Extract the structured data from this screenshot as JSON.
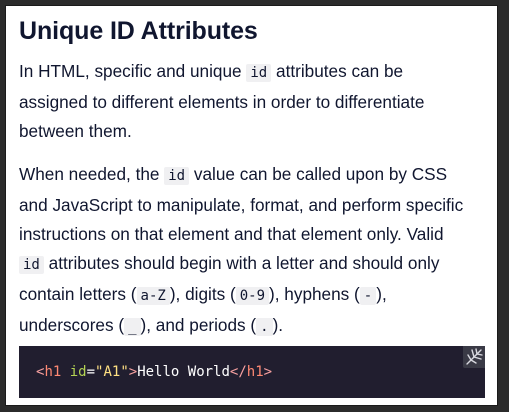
{
  "title": "Unique ID Attributes",
  "paragraph1": {
    "line1": {
      "before": "In HTML, specific and unique ",
      "code": "id",
      "after": " attributes can be"
    },
    "line2": "assigned to different elements in order to differentiate",
    "line3": "between them."
  },
  "paragraph2": {
    "line1": {
      "before": "When needed, the ",
      "code": "id",
      "after": " value can be called upon by CSS"
    },
    "line2": "and JavaScript to manipulate, format, and perform specific",
    "line3": "instructions on that element and that element only. Valid",
    "line4": {
      "code": "id",
      "after": " attributes should begin with a letter and should only"
    },
    "line5": {
      "t1": "contain letters (",
      "c1": "a-Z",
      "t2": "), digits (",
      "c2": "0-9",
      "t3": "), hyphens (",
      "c3": "-",
      "t4": "),"
    },
    "line6": {
      "t1": "underscores (",
      "c1": "_",
      "t2": "), and periods (",
      "c2": ".",
      "t3": ")."
    }
  },
  "code_example": {
    "open_lt": "<",
    "tag_open": "h1",
    "space": " ",
    "attr": "id",
    "eq": "=",
    "value": "\"A1\"",
    "open_gt": ">",
    "text": "Hello World",
    "close_lt": "</",
    "tag_close": "h1",
    "close_gt": ">"
  },
  "icons": {
    "expand": "expand-icon"
  }
}
